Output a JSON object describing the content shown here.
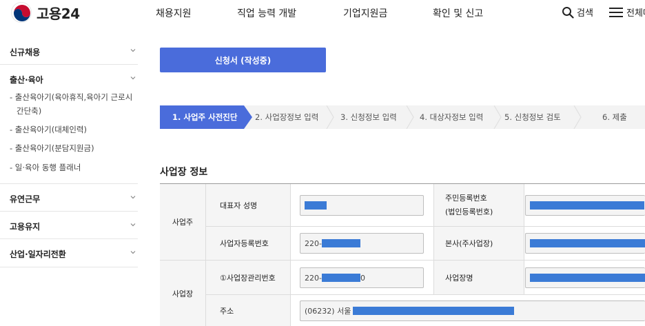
{
  "header": {
    "logo_text": "고용24",
    "nav": [
      "채용지원",
      "직업 능력 개발",
      "기업지원금",
      "확인 및 신고"
    ],
    "search_label": "검색",
    "menu_label": "전체메뉴"
  },
  "sidebar": {
    "sections": [
      {
        "label": "신규채용"
      },
      {
        "label": "출산·육아"
      },
      {
        "label": "유연근무"
      },
      {
        "label": "고용유지"
      },
      {
        "label": "산업·일자리전환"
      }
    ],
    "sub_items": [
      {
        "line1": "- 출산육아기(육아휴직,육아기 근로시",
        "line2": "간단축)"
      },
      {
        "line1": "- 출산육아기(대체인력)"
      },
      {
        "line1": "- 출산육아기(분담지원금)"
      },
      {
        "line1": "- 일·육아 동행 플래너"
      }
    ]
  },
  "main": {
    "status_button": "신청서 (작성중)",
    "steps": [
      "1. 사업주 사전진단",
      "2. 사업장정보 입력",
      "3. 신청정보 입력",
      "4. 대상자정보 입력",
      "5. 신청정보 검토",
      "6. 제출"
    ],
    "active_step": 0,
    "section_title": "사업장 정보",
    "table": {
      "group_employer": "사업주",
      "group_workplace": "사업장",
      "rep_name_label": "대표자 성명",
      "rrn_label_1": "주민등록번호",
      "rrn_label_2": "(법인등록번호)",
      "biz_no_label": "사업자등록번호",
      "biz_no_prefix": "220-",
      "hq_label": "본사(주사업장)",
      "workplace_no_label": "①사업장관리번호",
      "workplace_no_prefix": "220-",
      "workplace_no_suffix": "0",
      "workplace_name_label": "사업장명",
      "address_label": "주소",
      "address_prefix": "(06232) 서울"
    }
  },
  "colors": {
    "accent": "#4a6cdb",
    "redaction": "#3b7bd6"
  }
}
